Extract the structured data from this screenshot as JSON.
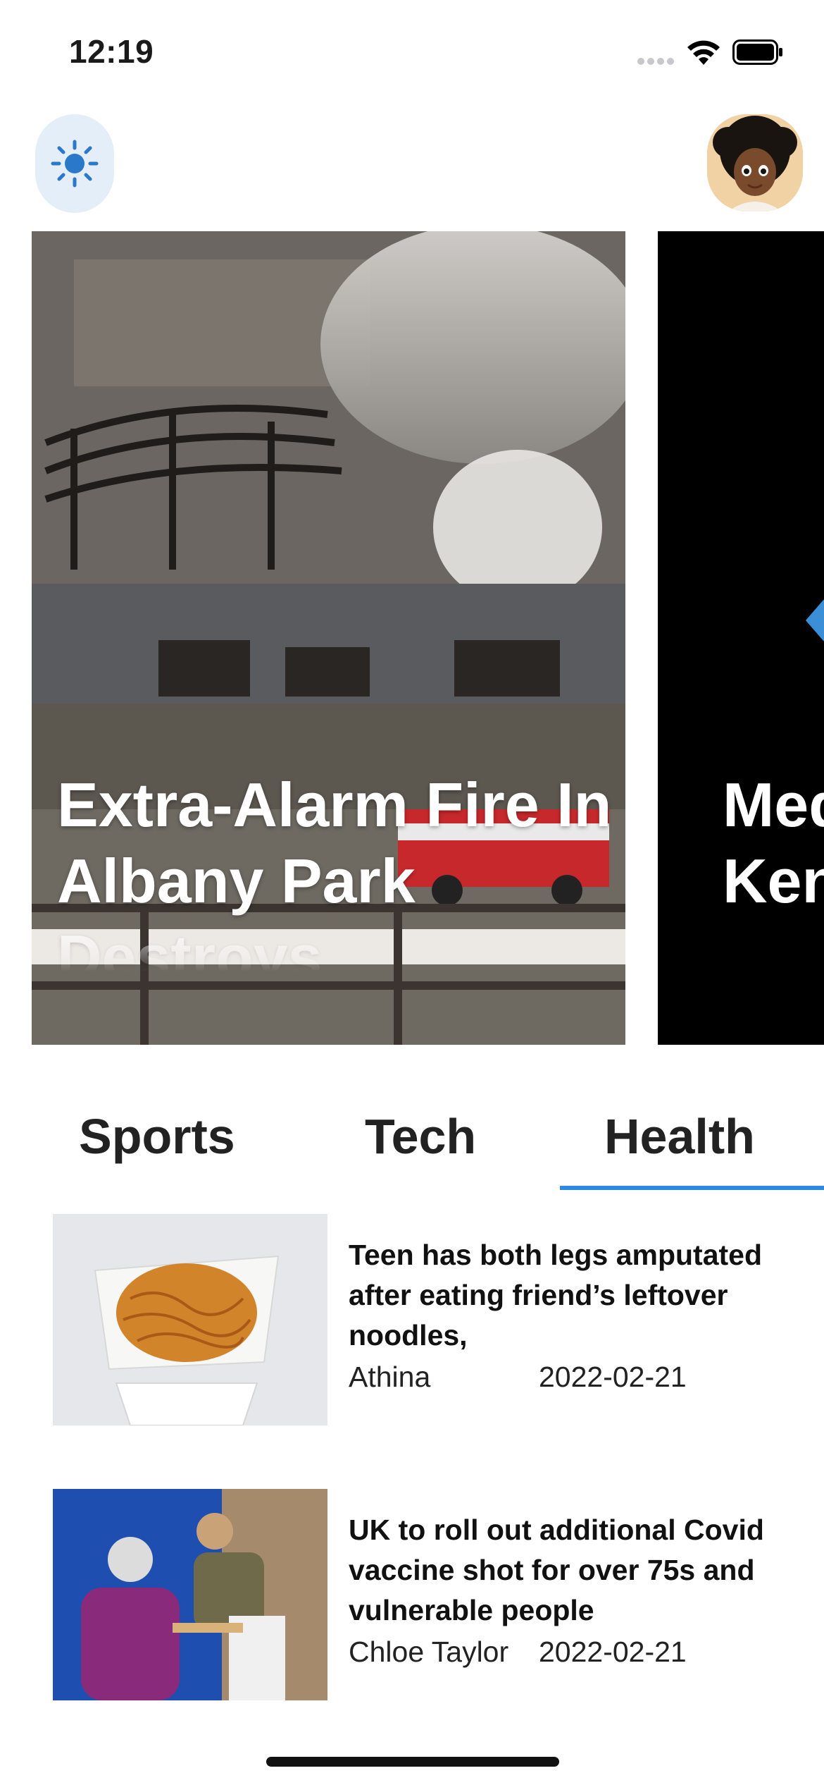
{
  "status_bar": {
    "time": "12:19"
  },
  "carousel": {
    "cards": [
      {
        "title": "Extra-Alarm Fire In Albany Park Destroys"
      },
      {
        "title": "Med Stri Ken"
      }
    ]
  },
  "tabs": [
    {
      "label": "Sports",
      "active": false
    },
    {
      "label": "Tech",
      "active": false
    },
    {
      "label": "Health",
      "active": true
    }
  ],
  "articles": [
    {
      "headline": "Teen has both legs amputated after eating friend’s leftover noodles,",
      "author": "Athina",
      "date": "2022-02-21",
      "thumbnail": "noodles-takeout-box"
    },
    {
      "headline": "UK to roll out additional Covid vaccine shot for over 75s and vulnerable people",
      "author": "Chloe Taylor",
      "date": "2022-02-21",
      "thumbnail": "vaccination-scene"
    }
  ],
  "colors": {
    "accent": "#2d8ae0",
    "theme_button_bg": "#e3eef9",
    "sun_icon": "#2a78c9"
  }
}
